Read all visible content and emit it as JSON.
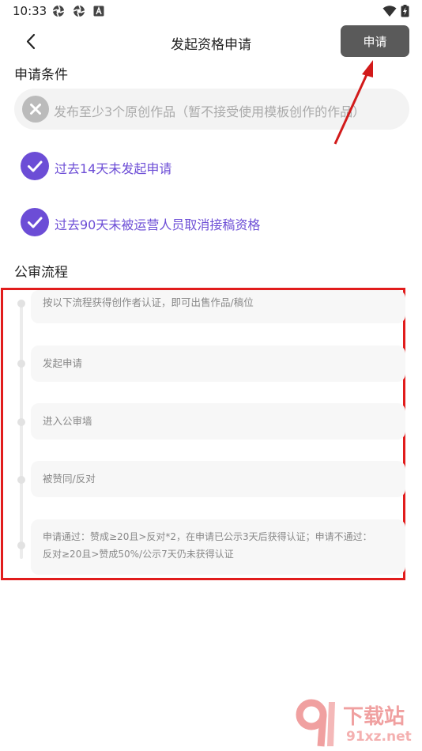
{
  "status_bar": {
    "time": "10:33",
    "icons": [
      "app-notification-icon",
      "app-notification-icon",
      "a-badge-icon",
      "wifi-icon",
      "battery-charging-icon"
    ]
  },
  "header": {
    "title": "发起资格申请",
    "apply_label": "申请"
  },
  "conditions": {
    "title": "申请条件",
    "items": [
      {
        "text": "发布至少3个原创作品（暂不接受使用模板创作的作品）",
        "met": false
      },
      {
        "text": "过去14天未发起申请",
        "met": true
      },
      {
        "text": "过去90天未被运营人员取消接稿资格",
        "met": true
      }
    ]
  },
  "process": {
    "title": "公审流程",
    "steps": [
      {
        "lines": [
          "按以下流程获得创作者认证，即可出售作品/稿位"
        ]
      },
      {
        "lines": [
          "发起申请"
        ]
      },
      {
        "lines": [
          "进入公审墙"
        ]
      },
      {
        "lines": [
          "被赞同/反对"
        ]
      },
      {
        "lines": [
          "申请通过：赞成≥20且>反对*2，在申请已公示3天后获得认证；申请不通过：",
          "反对≥20且>赞成50%/公示7天仍未获得认证"
        ]
      }
    ]
  },
  "colors": {
    "accent": "#6c4dd6",
    "apply_button": "#5a5a5a",
    "annotation": "#e11c1c"
  },
  "watermark": {
    "brand": "下载站",
    "url": "91xz.net"
  }
}
